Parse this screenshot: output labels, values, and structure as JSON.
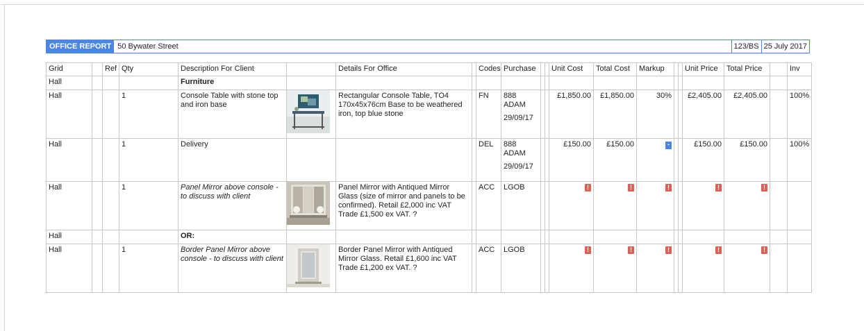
{
  "header": {
    "badge": "OFFICE REPORT",
    "address": "50 Bywater Street",
    "ref": "123/BS",
    "date": "25 July 2017"
  },
  "columns": {
    "grid": "Grid",
    "ref": "Ref",
    "qty": "Qty",
    "description": "Description For Client",
    "details": "Details For Office",
    "codes": "Codes",
    "purchase": "Purchase",
    "unit_cost": "Unit Cost",
    "total_cost": "Total Cost",
    "markup": "Markup",
    "unit_price": "Unit Price",
    "total_price": "Total Price",
    "inv": "Inv"
  },
  "rows": [
    {
      "grid": "Hall",
      "description": "Furniture"
    },
    {
      "grid": "Hall",
      "qty": "1",
      "description": "Console Table with stone top and iron base",
      "details": "Rectangular Console Table, TO4 170x45x76cm Base to be weathered iron, top blue stone",
      "codes": "FN",
      "purchase": "888 ADAM",
      "purchase_date": "29/09/17",
      "unit_cost": "£1,850.00",
      "total_cost": "£1,850.00",
      "markup": "30%",
      "unit_price": "£2,405.00",
      "total_price": "£2,405.00",
      "inv": "100%"
    },
    {
      "grid": "Hall",
      "qty": "1",
      "description": "Delivery",
      "codes": "DEL",
      "purchase": "888 ADAM",
      "purchase_date": "29/09/17",
      "unit_cost": "£150.00",
      "total_cost": "£150.00",
      "unit_price": "£150.00",
      "total_price": "£150.00",
      "inv": "100%"
    },
    {
      "grid": "Hall",
      "qty": "1",
      "description": "Panel Mirror above console - to discuss with client",
      "details": "Panel Mirror with Antiqued Mirror Glass (size of mirror and panels to be confirmed). Retail £2,000 inc VAT Trade £1,500 ex VAT. ?",
      "codes": "ACC",
      "purchase": "LGOB"
    },
    {
      "grid": "Hall",
      "description": "OR:"
    },
    {
      "grid": "Hall",
      "qty": "1",
      "description": "Border Panel Mirror above console - to discuss with client",
      "details": "Border Panel Mirror with Antiqued Mirror Glass. Retail £1,600 inc VAT Trade £1,200 ex VAT. ?",
      "codes": "ACC",
      "purchase": "LGOB"
    }
  ],
  "flags": {
    "warning": "!",
    "blank": "-"
  },
  "colors": {
    "accent": "#4a86e8",
    "warning": "#e06055"
  }
}
